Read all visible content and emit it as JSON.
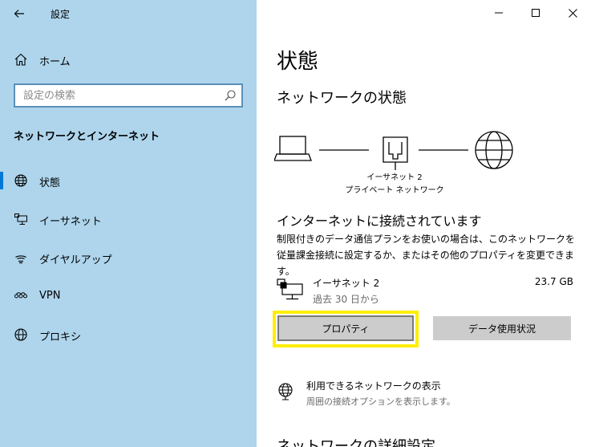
{
  "window": {
    "title": "設定"
  },
  "sidebar": {
    "home_label": "ホーム",
    "search": {
      "placeholder": "設定の検索"
    },
    "section_heading": "ネットワークとインターネット",
    "items": [
      {
        "label": "状態",
        "icon": "globe-icon",
        "active": true
      },
      {
        "label": "イーサネット",
        "icon": "ethernet-icon",
        "active": false
      },
      {
        "label": "ダイヤルアップ",
        "icon": "dialup-icon",
        "active": false
      },
      {
        "label": "VPN",
        "icon": "vpn-icon",
        "active": false
      },
      {
        "label": "プロキシ",
        "icon": "proxy-globe-icon",
        "active": false
      }
    ]
  },
  "main": {
    "title": "状態",
    "network_status_heading": "ネットワークの状態",
    "diagram": {
      "adapter_name": "イーサネット 2",
      "network_name": "プライベート ネットワーク"
    },
    "status_heading": "インターネットに接続されています",
    "status_description": "制限付きのデータ通信プランをお使いの場合は、このネットワークを従量課金接続に設定するか、またはその他のプロパティを変更できます。",
    "adapter": {
      "name": "イーサネット 2",
      "period": "過去 30 日から",
      "usage": "23.7 GB"
    },
    "buttons": {
      "properties": "プロパティ",
      "data_usage": "データ使用状況"
    },
    "link": {
      "title": "利用できるネットワークの表示",
      "description": "周囲の接続オプションを表示します。"
    },
    "next_heading": "ネットワークの詳細設定"
  },
  "colors": {
    "sidebar_bg": "#aed5ec",
    "accent": "#0078d7",
    "highlight": "#ffee00",
    "button_bg": "#cccccc"
  }
}
